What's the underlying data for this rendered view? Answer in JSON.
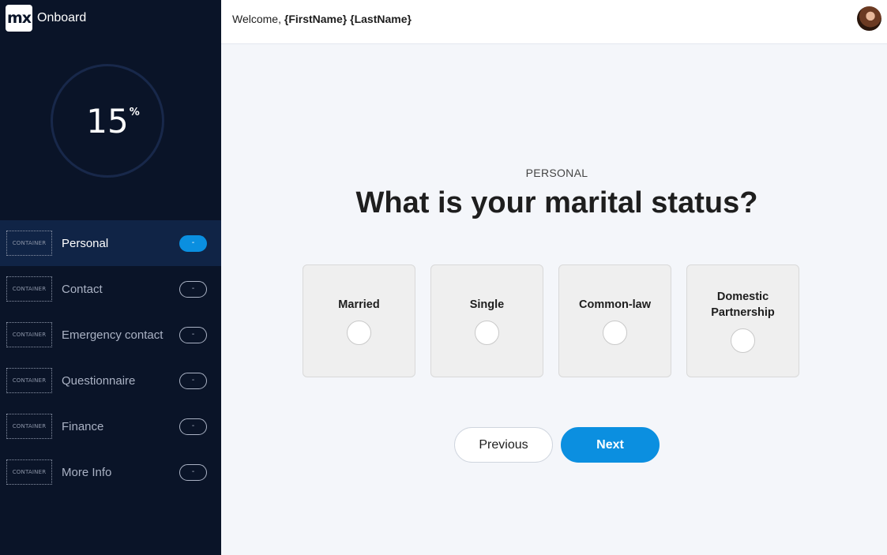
{
  "brand": {
    "logo": "mx",
    "name": "Onboard"
  },
  "progress": {
    "value": "15",
    "unit": "%"
  },
  "nav": [
    {
      "container_tag": "CONTAINER",
      "label": "Personal",
      "badge": "-",
      "active": true
    },
    {
      "container_tag": "CONTAINER",
      "label": "Contact",
      "badge": "-"
    },
    {
      "container_tag": "CONTAINER",
      "label": "Emergency contact",
      "badge": "-"
    },
    {
      "container_tag": "CONTAINER",
      "label": "Questionnaire",
      "badge": "-"
    },
    {
      "container_tag": "CONTAINER",
      "label": "Finance",
      "badge": "-"
    },
    {
      "container_tag": "CONTAINER",
      "label": "More Info",
      "badge": "-"
    }
  ],
  "topbar": {
    "welcome_prefix": "Welcome, ",
    "welcome_name": "{FirstName} {LastName}"
  },
  "main": {
    "section": "PERSONAL",
    "question": "What is your marital status?",
    "options": [
      {
        "label": "Married"
      },
      {
        "label": "Single"
      },
      {
        "label": "Common-law"
      },
      {
        "label": "Domestic Partnership"
      }
    ],
    "previous_label": "Previous",
    "next_label": "Next"
  },
  "colors": {
    "sidebar_bg": "#0a1428",
    "active_item_bg": "#102446",
    "accent": "#0b8fe0",
    "main_bg": "#f4f6fa"
  }
}
